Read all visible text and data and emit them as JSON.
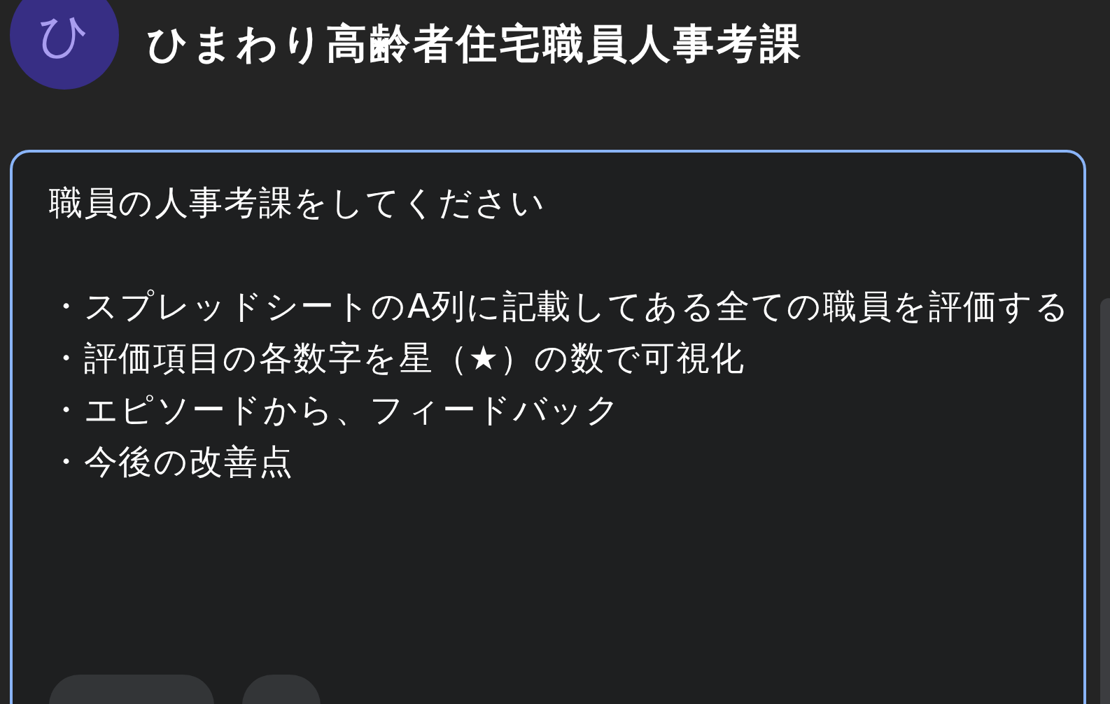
{
  "header": {
    "avatar_letter": "ひ",
    "title": "ひまわり高齢者住宅職員人事考課"
  },
  "prompt": {
    "heading": "職員の人事考課をしてください",
    "bullets": [
      "・スプレッドシートのA列に記載してある全ての職員を評価する",
      "・評価項目の各数字を星（★）の数で可視化",
      "・エピソードから、フィードバック",
      "・今後の改善点"
    ]
  }
}
